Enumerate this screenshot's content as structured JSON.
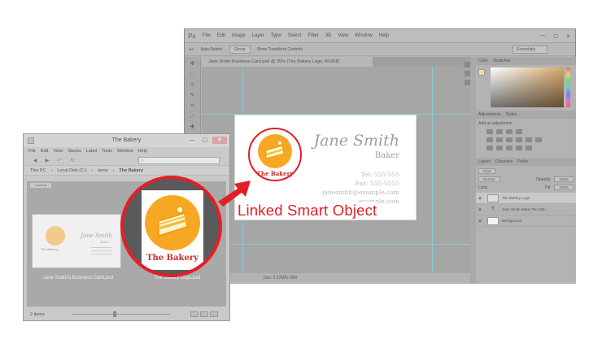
{
  "photoshop": {
    "logo": "Ps",
    "menus": [
      "File",
      "Edit",
      "Image",
      "Layer",
      "Type",
      "Select",
      "Filter",
      "3D",
      "View",
      "Window",
      "Help"
    ],
    "window_controls": [
      "—",
      "▢",
      "✕"
    ],
    "options": {
      "auto_select": "Auto-Select:",
      "group": "Group",
      "show_transform": "Show Transform Controls",
      "workspace": "Essentials"
    },
    "doc_tab": "Jane Smith Business Card.psd @ 35% (The Bakery Logo, RGB/8)",
    "status": "Doc: 2.17M/5.79M",
    "panels": {
      "color_tabs": [
        "Color",
        "Swatches"
      ],
      "adjust_tabs": [
        "Adjustments",
        "Styles"
      ],
      "adjust_hint": "Add an adjustment",
      "layer_tabs": [
        "Layers",
        "Channels",
        "Paths"
      ],
      "kind": "Kind",
      "blend": "Normal",
      "opacity_label": "Opacity:",
      "opacity": "100%",
      "lock_label": "Lock:",
      "fill_label": "Fill:",
      "fill": "100%",
      "layers": [
        {
          "name": "The Bakery Logo"
        },
        {
          "name": "Jane Smith  Baker  Tel: 555-..."
        },
        {
          "name": "Background"
        }
      ]
    }
  },
  "business_card": {
    "name": "Jane Smith",
    "title": "Baker",
    "tel": "Tel: 555-555",
    "fax": "Fax: 555-5555",
    "email1": "janesmith@example.com",
    "email2": "example.com",
    "logo_text": "The Bakery"
  },
  "callout": {
    "label": "Linked Smart Object"
  },
  "explorer": {
    "title": "The Bakery",
    "window_controls": [
      "—",
      "▢",
      "✕"
    ],
    "menus": [
      "File",
      "Edit",
      "View",
      "Stacks",
      "Label",
      "Tools",
      "Window",
      "Help"
    ],
    "breadcrumb": [
      "This PC",
      "Local Disk (C:)",
      "temp",
      "The Bakery"
    ],
    "search_placeholder": "⌕",
    "content_tab": "Content",
    "items": [
      {
        "caption": "Jane Smith's Business Card.psd"
      },
      {
        "caption": "The Bakery Logo.psd"
      }
    ],
    "thumb_card": {
      "name": "Jane Smith",
      "title": "Baker",
      "logo_text": "The Bakery"
    },
    "status": "2 items"
  },
  "magnifier": {
    "logo_text": "The Bakery"
  },
  "colors": {
    "accent_red": "#e31f26",
    "logo_orange": "#f7a823",
    "logo_text_red": "#cc2a2a"
  }
}
